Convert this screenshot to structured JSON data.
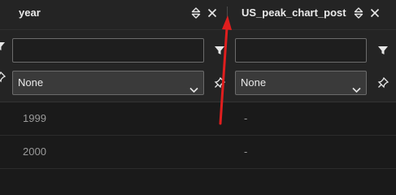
{
  "columns": [
    {
      "title": "year",
      "filter_value": "",
      "select_value": "None"
    },
    {
      "title": "US_peak_chart_post",
      "filter_value": "",
      "select_value": "None"
    }
  ],
  "rows": [
    {
      "year": "1999",
      "US_peak_chart_post": "-"
    },
    {
      "year": "2000",
      "US_peak_chart_post": "-"
    }
  ],
  "icons": {
    "sort": "sort-icon",
    "close": "close-icon",
    "filter": "filter-icon",
    "pin": "pin-icon",
    "chevron": "chevron-down-icon"
  },
  "colors": {
    "background": "#1a1a1a",
    "header": "#242424",
    "annotation_arrow": "#e01e1e"
  }
}
